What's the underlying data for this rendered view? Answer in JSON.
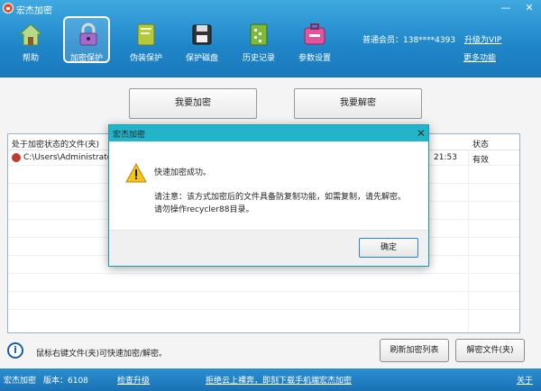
{
  "window": {
    "title": "宏杰加密",
    "minimize": "—",
    "close": "✕"
  },
  "toolbar": {
    "items": [
      {
        "label": "帮助",
        "icon": "home-icon"
      },
      {
        "label": "加密保护",
        "icon": "lock-icon",
        "active": true
      },
      {
        "label": "伪装保护",
        "icon": "book-icon"
      },
      {
        "label": "保护磁盘",
        "icon": "disk-icon"
      },
      {
        "label": "历史记录",
        "icon": "history-icon"
      },
      {
        "label": "参数设置",
        "icon": "settings-icon"
      }
    ],
    "vip_label": "普通会员：138****4393",
    "upgrade_label": "升级为VIP",
    "more_label": "更多功能"
  },
  "main": {
    "encrypt_button": "我要加密",
    "decrypt_button": "我要解密",
    "list": {
      "header_file": "处于加密状态的文件(夹)",
      "header_status": "状态",
      "rows": [
        {
          "path": "C:\\Users\\Administrator\\",
          "time": "21:53",
          "status": "有效"
        }
      ]
    },
    "hint_icon_text": "i",
    "hint": "鼠标右键文件(夹)可快速加密/解密。",
    "refresh_button": "刷新加密列表",
    "decrypt_file_button": "解密文件(夹)"
  },
  "statusbar": {
    "app_name": "宏杰加密",
    "version": "版本：6108",
    "check_update": "检查升级",
    "promo": "拒绝云上裸奔，即刻下载手机端宏杰加密",
    "about": "关于"
  },
  "dialog": {
    "title": "宏杰加密",
    "close": "✕",
    "message": "快速加密成功。",
    "note_line1": "请注意：该方式加密后的文件具备防复制功能，如需复制，请先解密。",
    "note_line2": "请勿操作recycler88目录。",
    "ok_button": "确定"
  },
  "colors": {
    "header": "#1f86c9",
    "dialog_title": "#22b5c9",
    "warning": "#f5c518"
  }
}
